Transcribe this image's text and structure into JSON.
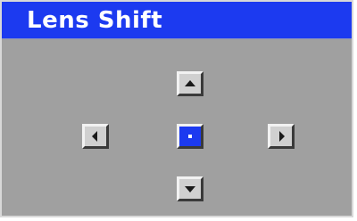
{
  "window": {
    "title": "Lens Shift"
  },
  "controls": {
    "up": {
      "icon": "triangle-up-icon"
    },
    "down": {
      "icon": "triangle-down-icon"
    },
    "left": {
      "icon": "triangle-left-icon"
    },
    "right": {
      "icon": "triangle-right-icon"
    },
    "center": {
      "icon": "center-dot-icon",
      "selected": true
    }
  },
  "colors": {
    "title_bar": "#1c3af0",
    "panel_background": "#a0a0a0",
    "button_face": "#d0d0d0",
    "selected_button": "#1c3af0"
  }
}
